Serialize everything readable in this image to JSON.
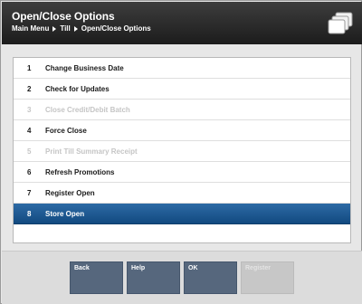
{
  "header": {
    "title": "Open/Close Options",
    "breadcrumb": [
      "Main Menu",
      "Till",
      "Open/Close Options"
    ]
  },
  "menu": {
    "items": [
      {
        "num": "1",
        "label": "Change Business Date",
        "state": "enabled"
      },
      {
        "num": "2",
        "label": "Check for Updates",
        "state": "enabled"
      },
      {
        "num": "3",
        "label": "Close Credit/Debit Batch",
        "state": "disabled"
      },
      {
        "num": "4",
        "label": "Force Close",
        "state": "enabled"
      },
      {
        "num": "5",
        "label": "Print Till Summary Receipt",
        "state": "disabled"
      },
      {
        "num": "6",
        "label": "Refresh Promotions",
        "state": "enabled"
      },
      {
        "num": "7",
        "label": "Register Open",
        "state": "enabled"
      },
      {
        "num": "8",
        "label": "Store Open",
        "state": "selected"
      }
    ]
  },
  "buttons": {
    "back": "Back",
    "help": "Help",
    "ok": "OK",
    "register": "Register"
  },
  "colors": {
    "header_bg": "#2b2b2b",
    "selected_row": "#1f5a92",
    "button": "#56677d",
    "button_disabled": "#c7c7c7"
  },
  "icons": {
    "header": "stacked-windows-icon"
  }
}
